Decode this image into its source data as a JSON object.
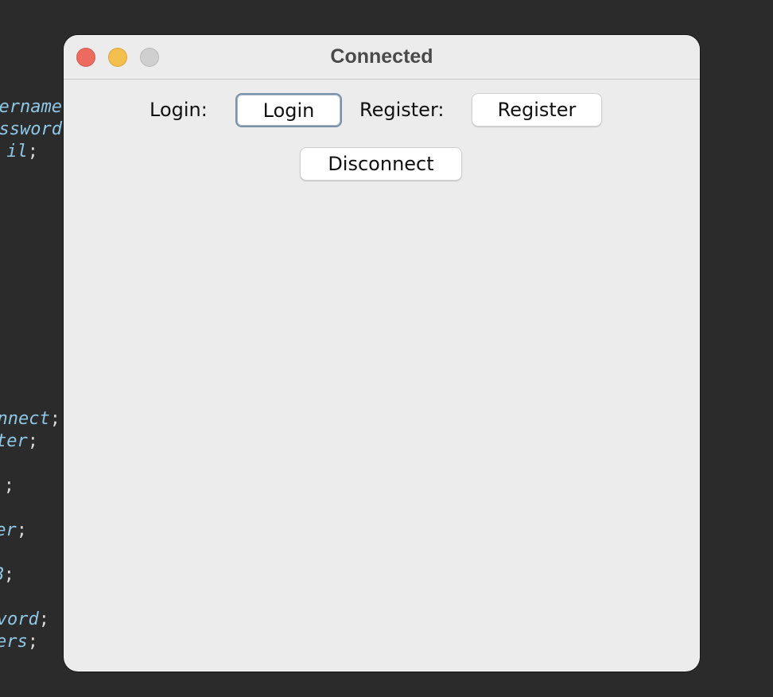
{
  "background_code": {
    "lines": [
      {
        "text": "ername",
        "semi": ""
      },
      {
        "text": "ssword",
        "semi": ""
      },
      {
        "text": "il",
        "semi": ";"
      },
      {
        "text": "nnect",
        "semi": ";"
      },
      {
        "text": "ter",
        "semi": ";"
      },
      {
        "text": "",
        "semi": ";"
      },
      {
        "text": "er",
        "semi": ";"
      },
      {
        "text": "B",
        "semi": ";"
      },
      {
        "text": "vord",
        "semi": ";"
      },
      {
        "text": "ers",
        "semi": ";"
      }
    ],
    "code_color": "#8fc7e6"
  },
  "window": {
    "title": "Connected",
    "traffic_lights": {
      "close": "#ed6a5e",
      "minimize": "#f5bf4f",
      "zoom": "#cfcfcf"
    }
  },
  "form": {
    "login_label": "Login:",
    "login_button": "Login",
    "register_label": "Register:",
    "register_button": "Register",
    "disconnect_button": "Disconnect"
  }
}
